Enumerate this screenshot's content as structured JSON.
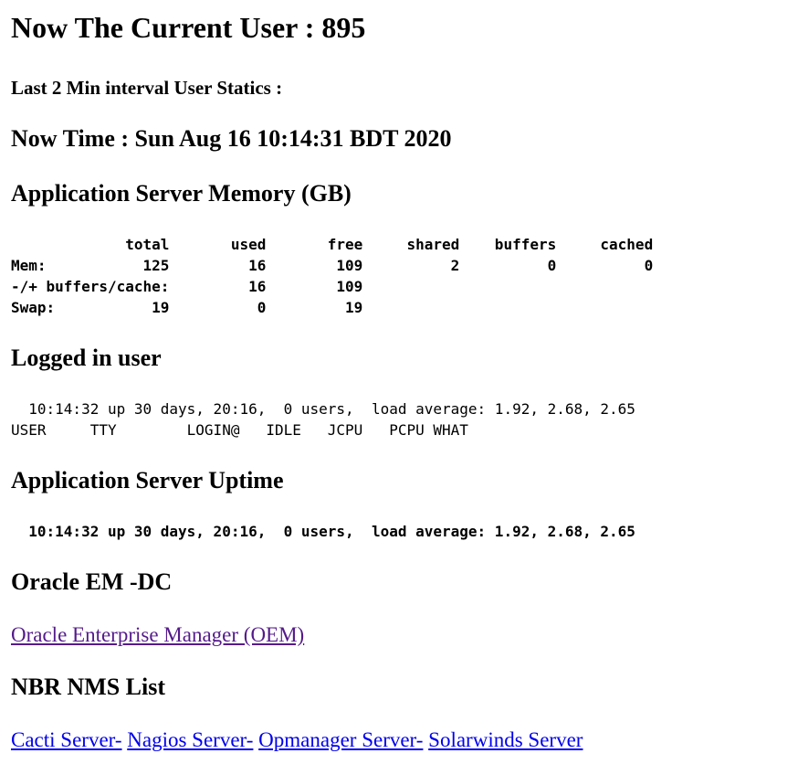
{
  "current_user": "Now The Current User : 895",
  "interval_stats": "Last 2 Min interval User Statics :",
  "now_time": "Now Time : Sun Aug 16 10:14:31 BDT 2020",
  "memory": {
    "heading": "Application Server Memory (GB)",
    "output": "             total       used       free     shared    buffers     cached\nMem:           125         16        109          2          0          0\n-/+ buffers/cache:         16        109\nSwap:           19          0         19"
  },
  "logged_in": {
    "heading": "Logged in user",
    "output": "  10:14:32 up 30 days, 20:16,  0 users,  load average: 1.92, 2.68, 2.65\nUSER     TTY        LOGIN@   IDLE   JCPU   PCPU WHAT"
  },
  "uptime": {
    "heading": "Application Server Uptime",
    "output": "  10:14:32 up 30 days, 20:16,  0 users,  load average: 1.92, 2.68, 2.65"
  },
  "oracle": {
    "heading": "Oracle EM -DC",
    "link": "Oracle Enterprise Manager (OEM)"
  },
  "nms": {
    "heading": "NBR NMS List",
    "links": [
      "Cacti Server-",
      "Nagios Server-",
      "Opmanager Server-",
      "Solarwinds Server"
    ]
  }
}
